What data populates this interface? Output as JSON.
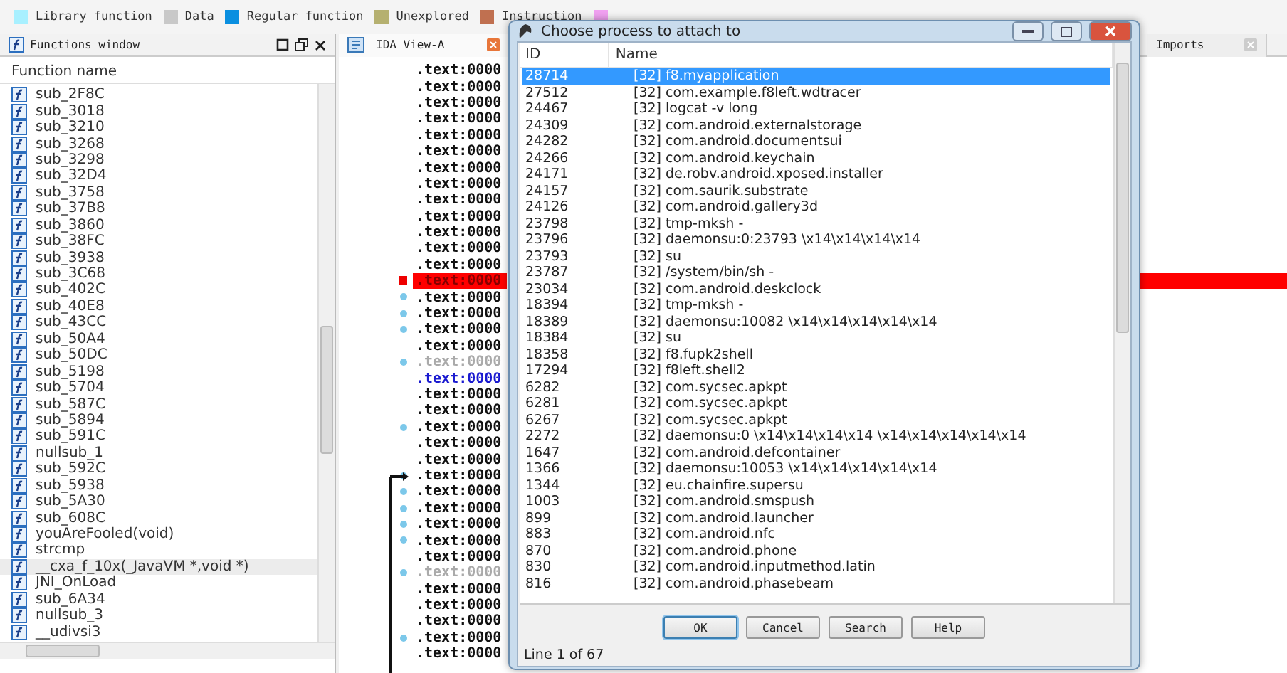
{
  "legend": [
    {
      "label": "Library function",
      "color": "#a8f0ff"
    },
    {
      "label": "Data",
      "color": "#c8c8c8"
    },
    {
      "label": "Regular function",
      "color": "#0a8fe0"
    },
    {
      "label": "Unexplored",
      "color": "#b5b070"
    },
    {
      "label": "Instruction",
      "color": "#c07050"
    },
    {
      "color": "#f0a0f0"
    }
  ],
  "functions_window": {
    "title": "Functions window",
    "column": "Function name",
    "items": [
      {
        "name": "sub_2F8C",
        "selected": false
      },
      {
        "name": "sub_3018",
        "selected": false
      },
      {
        "name": "sub_3210",
        "selected": false
      },
      {
        "name": "sub_3268",
        "selected": false
      },
      {
        "name": "sub_3298",
        "selected": false
      },
      {
        "name": "sub_32D4",
        "selected": false
      },
      {
        "name": "sub_3758",
        "selected": false
      },
      {
        "name": "sub_37B8",
        "selected": false
      },
      {
        "name": "sub_3860",
        "selected": false
      },
      {
        "name": "sub_38FC",
        "selected": false
      },
      {
        "name": "sub_3938",
        "selected": false
      },
      {
        "name": "sub_3C68",
        "selected": false
      },
      {
        "name": "sub_402C",
        "selected": false
      },
      {
        "name": "sub_40E8",
        "selected": false
      },
      {
        "name": "sub_43CC",
        "selected": false
      },
      {
        "name": "sub_50A4",
        "selected": false
      },
      {
        "name": "sub_50DC",
        "selected": false
      },
      {
        "name": "sub_5198",
        "selected": false
      },
      {
        "name": "sub_5704",
        "selected": false
      },
      {
        "name": "sub_587C",
        "selected": false
      },
      {
        "name": "sub_5894",
        "selected": false
      },
      {
        "name": "sub_591C",
        "selected": false
      },
      {
        "name": "nullsub_1",
        "selected": false
      },
      {
        "name": "sub_592C",
        "selected": false
      },
      {
        "name": "sub_5938",
        "selected": false
      },
      {
        "name": "sub_5A30",
        "selected": false
      },
      {
        "name": "sub_608C",
        "selected": false
      },
      {
        "name": "youAreFooled(void)",
        "selected": false
      },
      {
        "name": "strcmp",
        "selected": false
      },
      {
        "name": "__cxa_f_10x(_JavaVM *,void *)",
        "selected": true
      },
      {
        "name": "JNI_OnLoad",
        "selected": false
      },
      {
        "name": "sub_6A34",
        "selected": false
      },
      {
        "name": "nullsub_3",
        "selected": false
      },
      {
        "name": "__udivsi3",
        "selected": false
      }
    ]
  },
  "view_tabs": [
    {
      "label": "IDA View-A",
      "selected": true
    },
    {
      "label": "Imports",
      "selected": false
    }
  ],
  "disassembly": [
    {
      "text": ".text:0000",
      "kind": "normal",
      "marked": false
    },
    {
      "text": ".text:0000",
      "kind": "normal",
      "marked": false
    },
    {
      "text": ".text:0000",
      "kind": "normal",
      "marked": false
    },
    {
      "text": ".text:0000",
      "kind": "normal",
      "marked": false
    },
    {
      "text": ".text:0000",
      "kind": "normal",
      "marked": false
    },
    {
      "text": ".text:0000",
      "kind": "normal",
      "marked": false
    },
    {
      "text": ".text:0000",
      "kind": "normal",
      "marked": false
    },
    {
      "text": ".text:0000",
      "kind": "normal",
      "marked": false
    },
    {
      "text": ".text:0000",
      "kind": "normal",
      "marked": false
    },
    {
      "text": ".text:0000",
      "kind": "normal",
      "marked": false
    },
    {
      "text": ".text:0000",
      "kind": "normal",
      "marked": false
    },
    {
      "text": ".text:0000",
      "kind": "normal",
      "marked": false
    },
    {
      "text": ".text:0000",
      "kind": "normal",
      "marked": false
    },
    {
      "text": ".text:0000",
      "kind": "breakpoint",
      "marked": false
    },
    {
      "text": ".text:0000",
      "kind": "normal",
      "marked": true
    },
    {
      "text": ".text:0000",
      "kind": "normal",
      "marked": true
    },
    {
      "text": ".text:0000",
      "kind": "normal",
      "marked": true
    },
    {
      "text": ".text:0000",
      "kind": "normal",
      "marked": false
    },
    {
      "text": ".text:0000",
      "kind": "grey",
      "marked": true
    },
    {
      "text": ".text:0000",
      "kind": "current",
      "marked": false
    },
    {
      "text": ".text:0000",
      "kind": "normal",
      "marked": false
    },
    {
      "text": ".text:0000",
      "kind": "normal",
      "marked": false
    },
    {
      "text": ".text:0000",
      "kind": "normal",
      "marked": true
    },
    {
      "text": ".text:0000",
      "kind": "normal",
      "marked": false
    },
    {
      "text": ".text:0000",
      "kind": "normal",
      "marked": false
    },
    {
      "text": ".text:0000",
      "kind": "normal",
      "marked": true
    },
    {
      "text": ".text:0000",
      "kind": "normal",
      "marked": true
    },
    {
      "text": ".text:0000",
      "kind": "normal",
      "marked": true
    },
    {
      "text": ".text:0000",
      "kind": "normal",
      "marked": true
    },
    {
      "text": ".text:0000",
      "kind": "normal",
      "marked": true
    },
    {
      "text": ".text:0000",
      "kind": "normal",
      "marked": false
    },
    {
      "text": ".text:0000",
      "kind": "grey",
      "marked": true
    },
    {
      "text": ".text:0000",
      "kind": "normal",
      "marked": false
    },
    {
      "text": ".text:0000",
      "kind": "normal",
      "marked": false
    },
    {
      "text": ".text:0000",
      "kind": "normal",
      "marked": false
    },
    {
      "text": ".text:0000",
      "kind": "normal",
      "marked": true
    },
    {
      "text": ".text:0000",
      "kind": "normal",
      "marked": false
    }
  ],
  "dialog": {
    "title": "Choose process to attach to",
    "columns": [
      "ID",
      "Name"
    ],
    "rows": [
      {
        "id": "28714",
        "name": "[32] f8.myapplication",
        "selected": true
      },
      {
        "id": "27512",
        "name": "[32] com.example.f8left.wdtracer",
        "selected": false
      },
      {
        "id": "24467",
        "name": "[32] logcat -v long",
        "selected": false
      },
      {
        "id": "24309",
        "name": "[32] com.android.externalstorage",
        "selected": false
      },
      {
        "id": "24282",
        "name": "[32] com.android.documentsui",
        "selected": false
      },
      {
        "id": "24266",
        "name": "[32] com.android.keychain",
        "selected": false
      },
      {
        "id": "24171",
        "name": "[32] de.robv.android.xposed.installer",
        "selected": false
      },
      {
        "id": "24157",
        "name": "[32] com.saurik.substrate",
        "selected": false
      },
      {
        "id": "24126",
        "name": "[32] com.android.gallery3d",
        "selected": false
      },
      {
        "id": "23798",
        "name": "[32] tmp-mksh -",
        "selected": false
      },
      {
        "id": "23796",
        "name": "[32] daemonsu:0:23793 \\x14\\x14\\x14\\x14",
        "selected": false
      },
      {
        "id": "23793",
        "name": "[32] su",
        "selected": false
      },
      {
        "id": "23787",
        "name": "[32] /system/bin/sh -",
        "selected": false
      },
      {
        "id": "23034",
        "name": "[32] com.android.deskclock",
        "selected": false
      },
      {
        "id": "18394",
        "name": "[32] tmp-mksh -",
        "selected": false
      },
      {
        "id": "18389",
        "name": "[32] daemonsu:10082  \\x14\\x14\\x14\\x14\\x14",
        "selected": false
      },
      {
        "id": "18384",
        "name": "[32] su",
        "selected": false
      },
      {
        "id": "18358",
        "name": "[32] f8.fupk2shell",
        "selected": false
      },
      {
        "id": "17294",
        "name": "[32] f8left.shell2",
        "selected": false
      },
      {
        "id": "6282",
        "name": "[32] com.sycsec.apkpt",
        "selected": false
      },
      {
        "id": "6281",
        "name": "[32] com.sycsec.apkpt",
        "selected": false
      },
      {
        "id": "6267",
        "name": "[32] com.sycsec.apkpt",
        "selected": false
      },
      {
        "id": "2272",
        "name": "[32] daemonsu:0 \\x14\\x14\\x14\\x14 \\x14\\x14\\x14\\x14\\x14",
        "selected": false
      },
      {
        "id": "1647",
        "name": "[32] com.android.defcontainer",
        "selected": false
      },
      {
        "id": "1366",
        "name": "[32] daemonsu:10053  \\x14\\x14\\x14\\x14\\x14",
        "selected": false
      },
      {
        "id": "1344",
        "name": "[32] eu.chainfire.supersu",
        "selected": false
      },
      {
        "id": "1003",
        "name": "[32] com.android.smspush",
        "selected": false
      },
      {
        "id": "899",
        "name": "[32] com.android.launcher",
        "selected": false
      },
      {
        "id": "883",
        "name": "[32] com.android.nfc",
        "selected": false
      },
      {
        "id": "870",
        "name": "[32] com.android.phone",
        "selected": false
      },
      {
        "id": "830",
        "name": "[32] com.android.inputmethod.latin",
        "selected": false
      },
      {
        "id": "816",
        "name": "[32] com.android.phasebeam",
        "selected": false
      }
    ],
    "buttons": [
      {
        "label": "OK",
        "default": true
      },
      {
        "label": "Cancel",
        "default": false
      },
      {
        "label": "Search",
        "default": false
      },
      {
        "label": "Help",
        "default": false
      }
    ],
    "status": "Line 1 of 67"
  }
}
